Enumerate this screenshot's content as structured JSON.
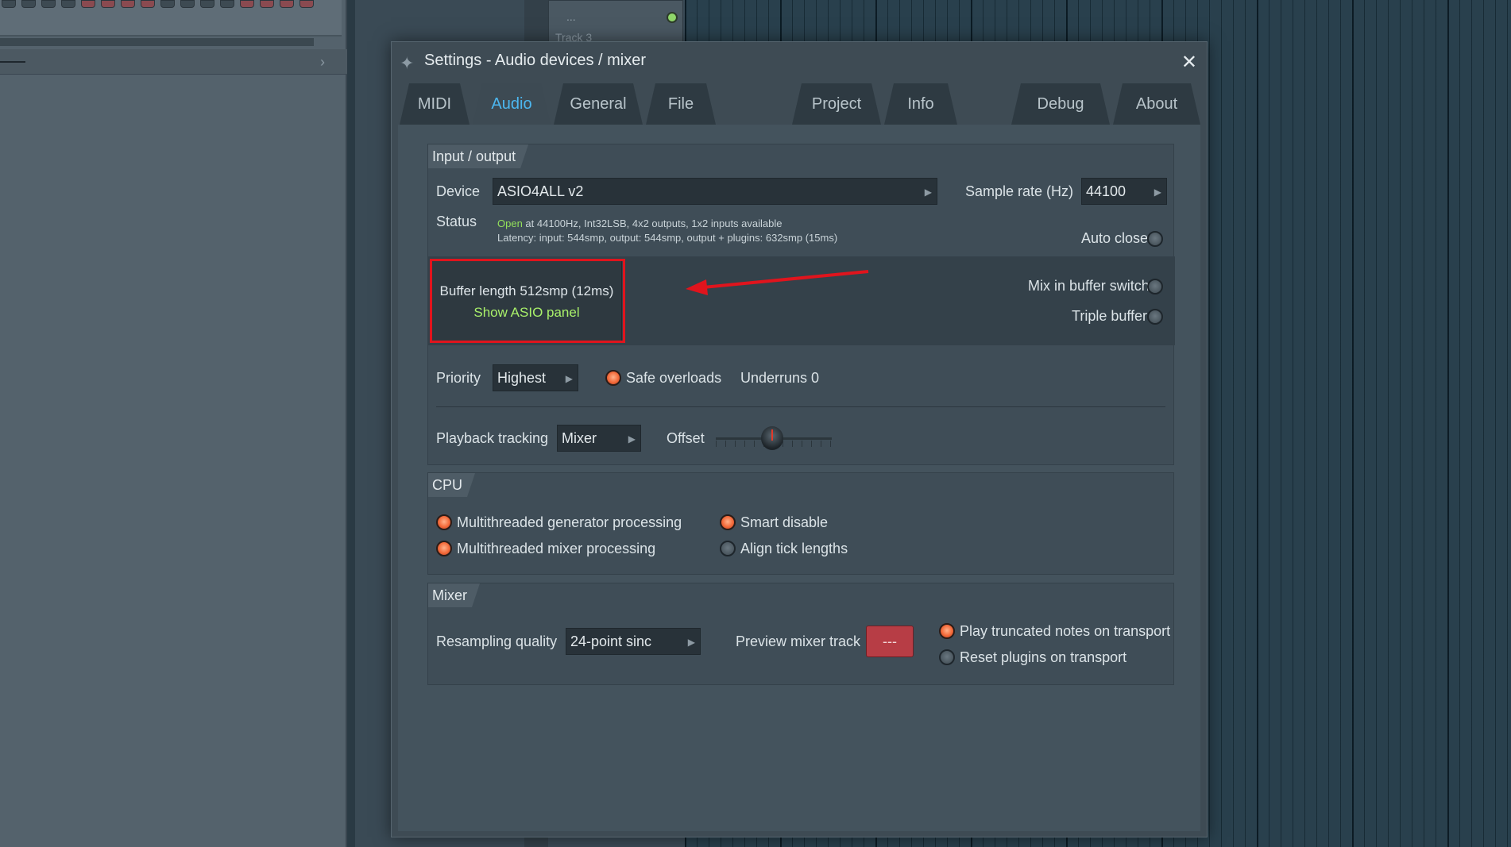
{
  "background": {
    "track_dots": "...",
    "track_label": "Track 3",
    "chevron_glyph": "›"
  },
  "dialog": {
    "title": "Settings - Audio devices / mixer",
    "title_icon": "fl-studio-settings-icon",
    "close_glyph": "✕",
    "tabs": [
      {
        "label": "MIDI",
        "active": false
      },
      {
        "label": "Audio",
        "active": true
      },
      {
        "label": "General",
        "active": false
      },
      {
        "label": "File",
        "active": false
      },
      {
        "label": "Project",
        "active": false
      },
      {
        "label": "Info",
        "active": false
      },
      {
        "label": "Debug",
        "active": false
      },
      {
        "label": "About",
        "active": false
      }
    ]
  },
  "io": {
    "section_label": "Input / output",
    "device_label": "Device",
    "device_value": "ASIO4ALL v2",
    "sample_rate_label": "Sample rate (Hz)",
    "sample_rate_value": "44100",
    "status_label": "Status",
    "status_open": "Open",
    "status_line1_rest": " at 44100Hz, Int32LSB, 4x2 outputs, 1x2 inputs available",
    "status_line2": "Latency: input: 544smp, output: 544smp, output + plugins: 632smp (15ms)",
    "auto_close_label": "Auto close",
    "auto_close_on": false,
    "buffer_length": "Buffer length 512smp (12ms)",
    "show_asio_panel": "Show ASIO panel",
    "mix_in_buffer_switch_label": "Mix in buffer switch",
    "mix_in_buffer_switch_on": false,
    "triple_buffer_label": "Triple buffer",
    "triple_buffer_on": false,
    "priority_label": "Priority",
    "priority_value": "Highest",
    "safe_overloads_label": "Safe overloads",
    "safe_overloads_on": true,
    "underruns_text": "Underruns 0",
    "playback_tracking_label": "Playback tracking",
    "playback_tracking_value": "Mixer",
    "offset_label": "Offset"
  },
  "cpu": {
    "section_label": "CPU",
    "options": [
      {
        "label": "Multithreaded generator processing",
        "on": true
      },
      {
        "label": "Multithreaded mixer processing",
        "on": true
      },
      {
        "label": "Smart disable",
        "on": true
      },
      {
        "label": "Align tick lengths",
        "on": false
      }
    ]
  },
  "mixer": {
    "section_label": "Mixer",
    "resampling_label": "Resampling quality",
    "resampling_value": "24-point sinc",
    "preview_track_label": "Preview mixer track",
    "preview_track_value": "---",
    "play_truncated_label": "Play truncated notes on transport",
    "play_truncated_on": true,
    "reset_plugins_label": "Reset plugins on transport",
    "reset_plugins_on": false
  },
  "colors": {
    "accent_tab": "#4cb7f0",
    "status_open": "#93e05a",
    "asio_link": "#a9f06a",
    "annotation_red": "#e0141d",
    "radio_on": "#f36a3a",
    "preview_button": "#b73d45"
  }
}
